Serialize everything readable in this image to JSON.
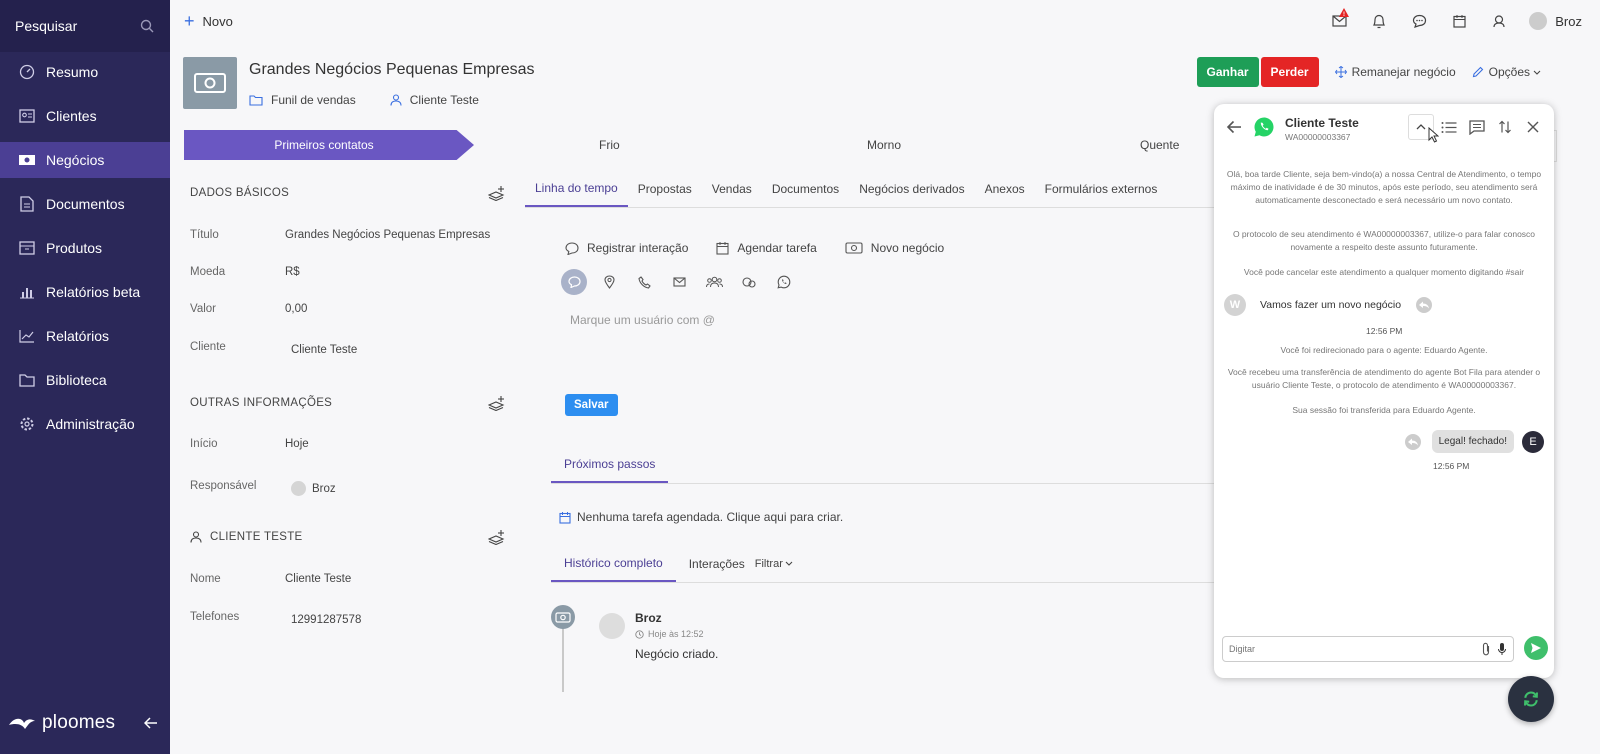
{
  "sidebar": {
    "search_label": "Pesquisar",
    "items": [
      {
        "label": "Resumo",
        "icon": "speedometer-icon"
      },
      {
        "label": "Clientes",
        "icon": "contacts-icon"
      },
      {
        "label": "Negócios",
        "icon": "money-icon"
      },
      {
        "label": "Documentos",
        "icon": "document-icon"
      },
      {
        "label": "Produtos",
        "icon": "box-icon"
      },
      {
        "label": "Relatórios beta",
        "icon": "bar-chart-icon"
      },
      {
        "label": "Relatórios",
        "icon": "line-chart-icon"
      },
      {
        "label": "Biblioteca",
        "icon": "folder-icon"
      },
      {
        "label": "Administração",
        "icon": "gear-icon"
      }
    ],
    "active_index": 2,
    "logo_text": "ploomes"
  },
  "topbar": {
    "new_label": "Novo",
    "user_name": "Broz",
    "alert_color": "#e42525"
  },
  "deal": {
    "title": "Grandes Negócios Pequenas Empresas",
    "pipeline": "Funil de vendas",
    "client": "Cliente Teste"
  },
  "actions": {
    "win": "Ganhar",
    "lose": "Perder",
    "move": "Remanejar negócio",
    "options": "Opções"
  },
  "stages": [
    "Primeiros contatos",
    "Frio",
    "Morno",
    "Quente"
  ],
  "left": {
    "basic_title": "DADOS BÁSICOS",
    "basic": [
      {
        "k": "Título",
        "v": "Grandes Negócios Pequenas Empresas"
      },
      {
        "k": "Moeda",
        "v": "R$"
      },
      {
        "k": "Valor",
        "v": "0,00"
      },
      {
        "k": "Cliente",
        "v": "Cliente Teste"
      }
    ],
    "other_title": "OUTRAS INFORMAÇÕES",
    "other": [
      {
        "k": "Início",
        "v": "Hoje"
      },
      {
        "k": "Responsável",
        "v": "Broz"
      }
    ],
    "client_title": "CLIENTE TESTE",
    "client": [
      {
        "k": "Nome",
        "v": "Cliente Teste"
      },
      {
        "k": "Telefones",
        "v": "12991287578"
      }
    ]
  },
  "tabs": [
    "Linha do tempo",
    "Propostas",
    "Vendas",
    "Documentos",
    "Negócios derivados",
    "Anexos",
    "Formulários externos"
  ],
  "interaction": {
    "register": "Registrar interação",
    "schedule": "Agendar tarefa",
    "new_deal": "Novo negócio",
    "mention_placeholder": "Marque um usuário com @",
    "save": "Salvar"
  },
  "next_steps": {
    "tab": "Próximos passos",
    "empty": "Nenhuma tarefa agendada. Clique aqui para criar."
  },
  "history": {
    "tabs": [
      "Histórico completo",
      "Interações"
    ],
    "filter": "Filtrar",
    "author": "Broz",
    "time": "Hoje às 12:52",
    "text": "Negócio criado."
  },
  "chat": {
    "name": "Cliente Teste",
    "protocol": "WA00000003367",
    "messages": {
      "welcome": "Olá, boa tarde Cliente, seja bem-vindo(a) a nossa Central de Atendimento, o tempo máximo de inatividade é de 30 minutos, após este período, seu atendimento será automaticamente desconectado e será necessário um novo contato.",
      "protocol_msg": "O protocolo de seu atendimento é WA00000003367, utilize-o para falar conosco novamente a respeito deste assunto futuramente.",
      "cancel_msg": "Você pode cancelar este atendimento a qualquer momento digitando #sair",
      "in_avatar": "W",
      "in_text": "Vamos fazer um novo negócio",
      "in_time": "12:56 PM",
      "redirect": "Você foi redirecionado para o agente: Eduardo Agente.",
      "transfer": "Você recebeu uma transferência de atendimento do agente Bot Fila para atender o usuário Cliente Teste, o protocolo de atendimento é WA00000003367.",
      "session": "Sua sessão foi transferida para Eduardo Agente.",
      "out_text": "Legal! fechado!",
      "out_avatar": "E",
      "out_time": "12:56 PM"
    },
    "input_placeholder": "Digitar",
    "whatsapp_color": "#25d366",
    "send_color": "#3fbf6b"
  }
}
